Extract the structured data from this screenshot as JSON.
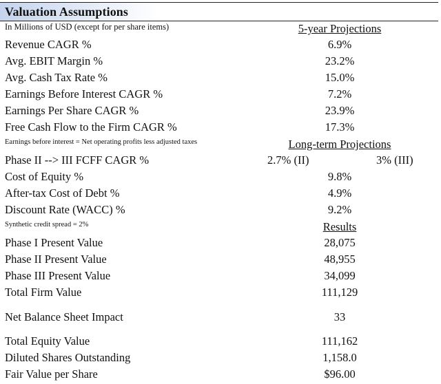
{
  "title": "Valuation Assumptions",
  "subtitle": "In Millions of USD (except for per share items)",
  "sections": {
    "five_year": {
      "header": "5-year Projections",
      "rows": [
        {
          "label": "Revenue CAGR %",
          "value": "6.9%"
        },
        {
          "label": "Avg. EBIT Margin %",
          "value": "23.2%"
        },
        {
          "label": "Avg. Cash Tax Rate %",
          "value": "15.0%"
        },
        {
          "label": "Earnings Before Interest CAGR %",
          "value": "7.2%"
        },
        {
          "label": "Earnings Per Share CAGR %",
          "value": "23.9%"
        },
        {
          "label": "Free Cash Flow to the Firm CAGR %",
          "value": "17.3%"
        }
      ],
      "note": "Earnings before interest = Net operating profits less adjusted taxes"
    },
    "long_term": {
      "header": "Long-term Projections",
      "phase_row": {
        "label": "Phase II --> III FCFF CAGR %",
        "value_phase2": "2.7% (II)",
        "value_phase3": "3% (III)"
      },
      "rows": [
        {
          "label": "Cost of Equity %",
          "value": "9.8%"
        },
        {
          "label": "After-tax Cost of Debt %",
          "value": "4.9%"
        },
        {
          "label": "Discount Rate (WACC) %",
          "value": "9.2%"
        }
      ],
      "note": "Synthetic credit spread = 2%"
    },
    "results": {
      "header": "Results",
      "rows": [
        {
          "label": "Phase I Present Value",
          "value": "28,075"
        },
        {
          "label": "Phase II Present Value",
          "value": "48,955"
        },
        {
          "label": "Phase III Present Value",
          "value": "34,099"
        },
        {
          "label": "Total Firm Value",
          "value": "111,129"
        }
      ],
      "balance": {
        "label": "Net Balance Sheet Impact",
        "value": "33"
      },
      "equity_rows": [
        {
          "label": "Total Equity Value",
          "value": "111,162"
        },
        {
          "label": "Diluted Shares Outstanding",
          "value": "1,158.0"
        },
        {
          "label": "Fair Value per Share",
          "value": "$96.00"
        }
      ]
    }
  },
  "colors": {
    "header_bg": "#c5d3ec",
    "text": "#111111"
  }
}
